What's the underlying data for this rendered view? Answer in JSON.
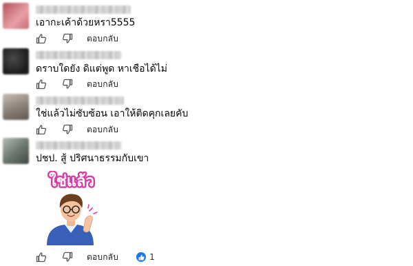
{
  "comments": [
    {
      "text": "เอากะเค้าด้วยหรา5555",
      "avatar_colors": [
        "#b3525e",
        "#e8a0a6"
      ],
      "reply_label": "ตอบกลับ"
    },
    {
      "text": "ดราบใดยัง ดิแต่พูด หาเชือได้ไม่",
      "avatar_colors": [
        "#1c1c1c",
        "#4a4a4a"
      ],
      "reply_label": "ตอบกลับ"
    },
    {
      "text": "ใช่แล้วไม่ซับซ้อน เอาให้ติดคุกเลยคับ",
      "avatar_colors": [
        "#8a7f78",
        "#c9bdb4"
      ],
      "reply_label": "ตอบกลับ"
    },
    {
      "text": "ปชป. สู้ ปริศนาธรรมกับเขา",
      "avatar_colors": [
        "#6f7a72",
        "#b4bcb6"
      ],
      "reply_label": "ตอบกลับ",
      "reaction_count": "1"
    }
  ],
  "sticker": {
    "text": "ใช่แล้ว"
  },
  "icons": {
    "like": "thumbs-up-icon",
    "dislike": "thumbs-down-icon",
    "reaction": "like-reaction-icon"
  },
  "colors": {
    "reaction_blue": "#1877f2",
    "sticker_pink": "#d63fa8"
  }
}
